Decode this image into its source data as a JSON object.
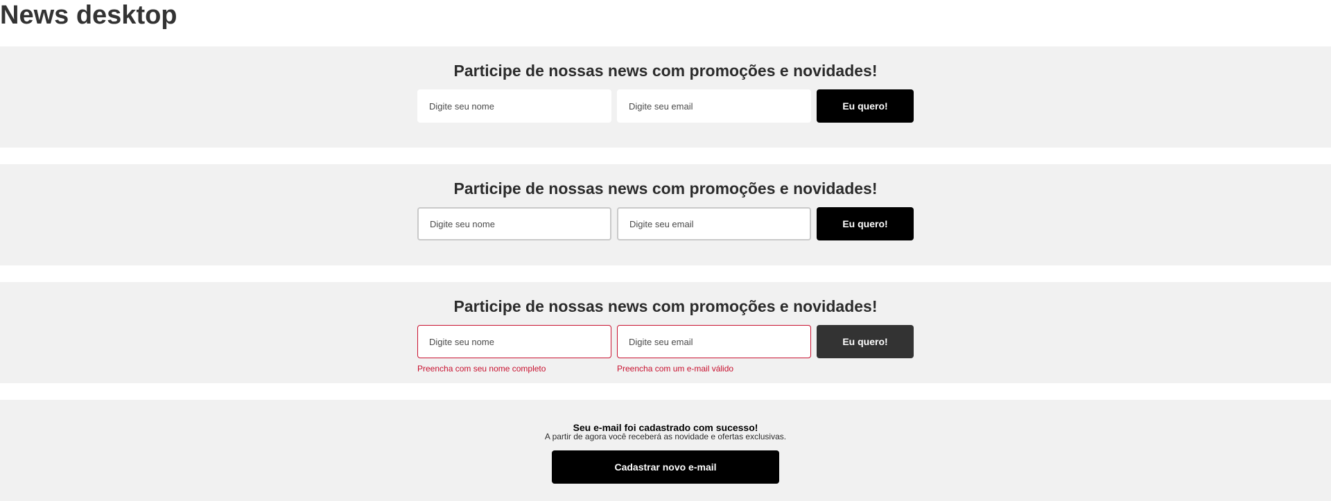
{
  "page_title": "News desktop",
  "colors": {
    "section_bg": "#f1f1f1",
    "button_bg": "#000000",
    "button_disabled_bg": "#333333",
    "error": "#c8102e",
    "focus_border": "#c9c9c9"
  },
  "news_default": {
    "heading": "Participe de nossas news com promoções e novidades!",
    "name_placeholder": "Digite seu nome",
    "email_placeholder": "Digite seu email",
    "submit_label": "Eu quero!"
  },
  "news_focus": {
    "heading": "Participe de nossas news com promoções e novidades!",
    "name_placeholder": "Digite seu nome",
    "email_placeholder": "Digite seu email",
    "submit_label": "Eu quero!"
  },
  "news_error": {
    "heading": "Participe de nossas news com promoções e novidades!",
    "name_placeholder": "Digite seu nome",
    "email_placeholder": "Digite seu email",
    "submit_label": "Eu quero!",
    "name_error": "Preencha com seu nome completo",
    "email_error": "Preencha com um e-mail válido"
  },
  "news_success": {
    "title": "Seu e-mail foi cadastrado com sucesso!",
    "subtitle": "A partir de agora você receberá as novidade e ofertas exclusivas.",
    "button_label": "Cadastrar novo e-mail"
  }
}
